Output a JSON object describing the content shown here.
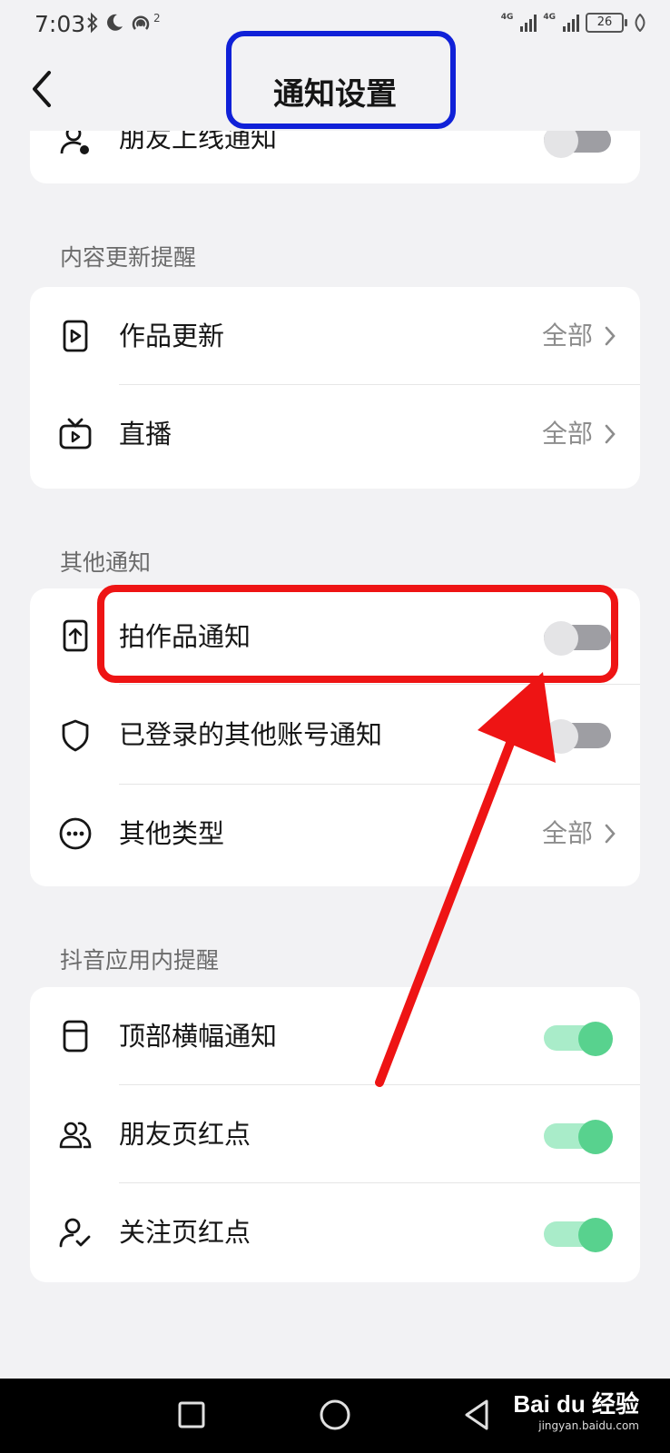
{
  "status": {
    "time": "7:03",
    "network_1": "4G",
    "network_2": "4G",
    "battery": "26",
    "hotspot_count": "2"
  },
  "header": {
    "title": "通知设置"
  },
  "top_card": {
    "item": {
      "label": "朋友上线通知",
      "toggle": false
    }
  },
  "sections": [
    {
      "title": "内容更新提醒",
      "items": [
        {
          "label": "作品更新",
          "value": "全部"
        },
        {
          "label": "直播",
          "value": "全部"
        }
      ]
    },
    {
      "title": "其他通知",
      "items": [
        {
          "label": "拍作品通知",
          "toggle": false
        },
        {
          "label": "已登录的其他账号通知",
          "toggle": false
        },
        {
          "label": "其他类型",
          "value": "全部"
        }
      ]
    },
    {
      "title": "抖音应用内提醒",
      "items": [
        {
          "label": "顶部横幅通知",
          "toggle": true
        },
        {
          "label": "朋友页红点",
          "toggle": true
        },
        {
          "label": "关注页红点",
          "toggle": true
        }
      ]
    }
  ],
  "watermark": {
    "logo": "Bai du 经验",
    "url": "jingyan.baidu.com"
  },
  "colors": {
    "annotation_blue": "#1021d8",
    "annotation_red": "#ee1414",
    "toggle_on": "#58d28e"
  }
}
